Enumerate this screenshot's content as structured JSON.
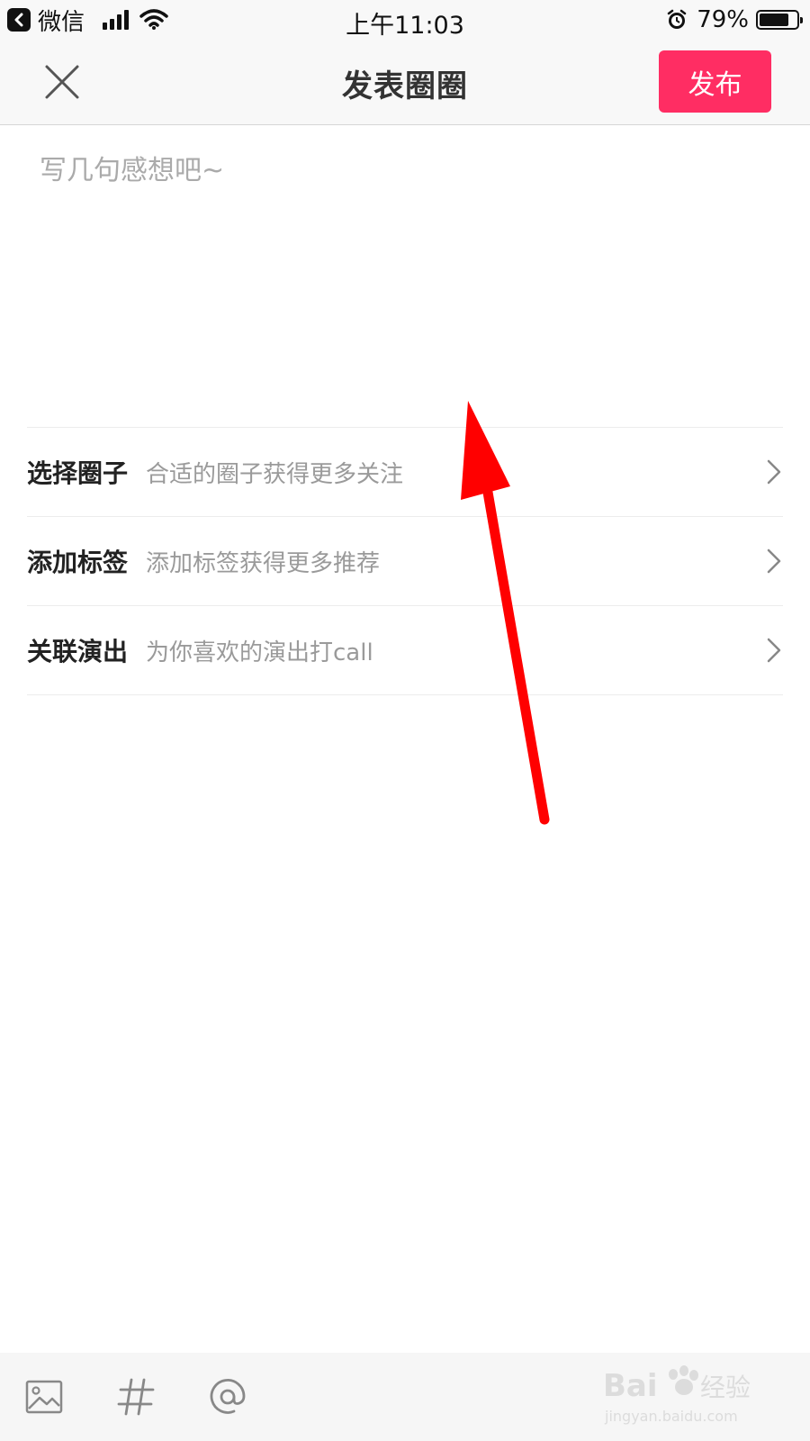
{
  "status_bar": {
    "back_app": "微信",
    "time": "上午11:03",
    "battery_percent": "79%",
    "battery_level": 0.79,
    "icons": [
      "back-arrow-icon",
      "signal-icon",
      "wifi-icon",
      "alarm-icon",
      "battery-icon"
    ]
  },
  "header": {
    "title": "发表圈圈",
    "publish_label": "发布",
    "close_icon": "close-icon"
  },
  "compose": {
    "placeholder": "写几句感想吧~",
    "value": ""
  },
  "options": [
    {
      "label": "选择圈子",
      "hint": "合适的圈子获得更多关注"
    },
    {
      "label": "添加标签",
      "hint": "添加标签获得更多推荐"
    },
    {
      "label": "关联演出",
      "hint": "为你喜欢的演出打call"
    }
  ],
  "toolbar": {
    "icons": [
      "image-icon",
      "hashtag-icon",
      "mention-icon"
    ]
  },
  "watermark": {
    "brand": "Bai",
    "brand_tail": "经验",
    "url": "jingyan.baidu.com"
  },
  "colors": {
    "accent": "#ff2d63",
    "annotation_arrow": "#ff0000"
  }
}
